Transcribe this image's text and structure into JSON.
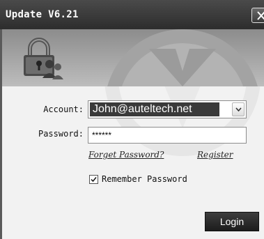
{
  "window": {
    "title": "Update V6.21",
    "close_icon": "close-icon",
    "banner_icon": "lock-users-icon"
  },
  "form": {
    "account_label": "Account:",
    "account_value": "John@auteltech.net",
    "password_label": "Password:",
    "password_value": "******",
    "forget_password_link": "Forget Password?",
    "register_link": "Register",
    "remember_label": "Remember Password",
    "remember_checked": true,
    "login_button": "Login"
  }
}
